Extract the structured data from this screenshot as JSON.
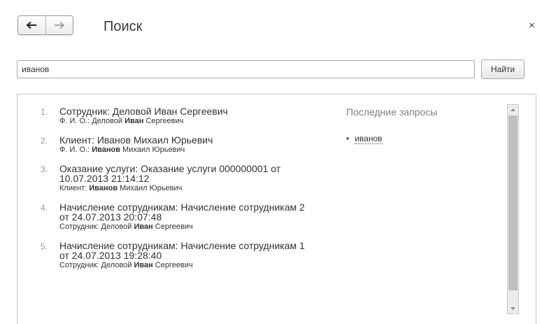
{
  "header": {
    "title": "Поиск",
    "back_icon": "arrow-left-icon",
    "forward_icon": "arrow-right-icon",
    "close_symbol": "×"
  },
  "search": {
    "value": "иванов",
    "button_label": "Найти"
  },
  "results": [
    {
      "number": "1.",
      "title_lines": [
        "Сотрудник: Деловой Иван Сергеевич"
      ],
      "detail_before": "Ф. И. О.: Деловой ",
      "detail_bold": "Иван",
      "detail_after": " Сергеевич"
    },
    {
      "number": "2.",
      "title_lines": [
        "Клиент: Иванов Михаил Юрьевич"
      ],
      "detail_before": "Ф. И. О.: ",
      "detail_bold": "Иванов",
      "detail_after": " Михаил Юрьевич"
    },
    {
      "number": "3.",
      "title_lines": [
        "Оказание услуги: Оказание услуги 000000001 от",
        "10.07.2013 21:14:12"
      ],
      "detail_before": "Клиент: ",
      "detail_bold": "Иванов",
      "detail_after": " Михаил Юрьевич"
    },
    {
      "number": "4.",
      "title_lines": [
        "Начисление сотрудникам: Начисление сотрудникам 2",
        "от 24.07.2013 20:07:48"
      ],
      "detail_before": "Сотрудник: Деловой ",
      "detail_bold": "Иван",
      "detail_after": " Сергеевич"
    },
    {
      "number": "5.",
      "title_lines": [
        "Начисление сотрудникам: Начисление сотрудникам 1",
        "от 24.07.2013 19:28:40"
      ],
      "detail_before": "Сотрудник: Деловой ",
      "detail_bold": "Иван",
      "detail_after": " Сергеевич"
    }
  ],
  "recent": {
    "label": "Последние запросы",
    "items": [
      "иванов"
    ]
  },
  "colors": {
    "text": "#333333",
    "muted": "#808080",
    "number": "#999999",
    "scroll_thumb": "#bfbfbf"
  }
}
